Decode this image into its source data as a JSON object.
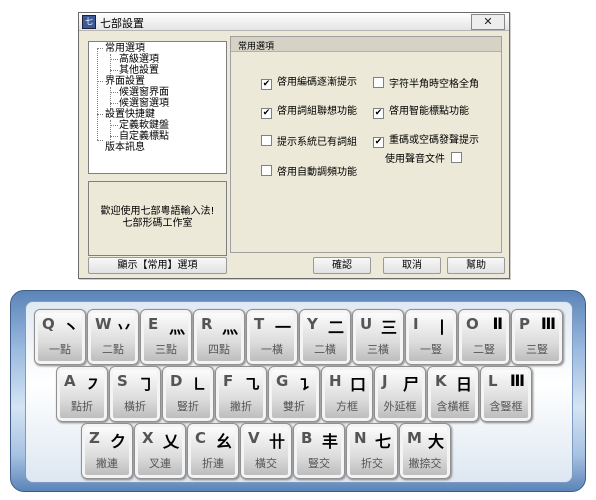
{
  "dialog": {
    "title": "七部設置",
    "app_icon": "七",
    "close_label": "✕",
    "tree": [
      {
        "label": "常用選項",
        "level": 0
      },
      {
        "label": "高級選項",
        "level": 1
      },
      {
        "label": "其他設置",
        "level": 1
      },
      {
        "label": "界面設置",
        "level": 0
      },
      {
        "label": "候選窗界面",
        "level": 1
      },
      {
        "label": "候選窗選項",
        "level": 1
      },
      {
        "label": "設置快捷鍵",
        "level": 0
      },
      {
        "label": "定義軟鍵盤",
        "level": 1
      },
      {
        "label": "自定義標點",
        "level": 1
      },
      {
        "label": "版本訊息",
        "level": 0
      }
    ],
    "welcome": {
      "line1": "歡迎使用七部粵語輸入法!",
      "line2": "七部形碼工作室"
    },
    "group_title": "常用選項",
    "options": [
      {
        "label": "啓用編碼逐漸提示",
        "checked": true
      },
      {
        "label": "字符半角時空格全角",
        "checked": false
      },
      {
        "label": "啓用詞組聯想功能",
        "checked": true
      },
      {
        "label": "啓用智能標點功能",
        "checked": true
      },
      {
        "label": "提示系統已有詞組",
        "checked": false
      },
      {
        "label": "重碼或空碼發聲提示",
        "checked": true
      },
      {
        "label": "啓用自動調頻功能",
        "checked": false
      }
    ],
    "sound_file_label": "使用聲音文件",
    "buttons": {
      "show": "顯示【常用】選項",
      "ok": "確認",
      "cancel": "取消",
      "help": "幫助"
    }
  },
  "keyboard": {
    "rows": [
      [
        {
          "letter": "Q",
          "stroke": "丶",
          "label": "一點"
        },
        {
          "letter": "W",
          "stroke": "丷",
          "label": "二點"
        },
        {
          "letter": "E",
          "stroke": "灬",
          "label": "三點"
        },
        {
          "letter": "R",
          "stroke": "灬",
          "label": "四點"
        },
        {
          "letter": "T",
          "stroke": "一",
          "label": "一橫"
        },
        {
          "letter": "Y",
          "stroke": "二",
          "label": "二橫"
        },
        {
          "letter": "U",
          "stroke": "三",
          "label": "三橫"
        },
        {
          "letter": "I",
          "stroke": "丨",
          "label": "一豎"
        },
        {
          "letter": "O",
          "stroke": "Ⅱ",
          "label": "二豎"
        },
        {
          "letter": "P",
          "stroke": "Ⅲ",
          "label": "三豎"
        }
      ],
      [
        {
          "letter": "A",
          "stroke": "㇇",
          "label": "點折"
        },
        {
          "letter": "S",
          "stroke": "㇆",
          "label": "橫折"
        },
        {
          "letter": "D",
          "stroke": "㇗",
          "label": "豎折"
        },
        {
          "letter": "F",
          "stroke": "㇈",
          "label": "撇折"
        },
        {
          "letter": "G",
          "stroke": "㇊",
          "label": "雙折"
        },
        {
          "letter": "H",
          "stroke": "口",
          "label": "方框"
        },
        {
          "letter": "J",
          "stroke": "尸",
          "label": "外延框"
        },
        {
          "letter": "K",
          "stroke": "日",
          "label": "含橫框"
        },
        {
          "letter": "L",
          "stroke": "Ⅲ",
          "label": "含豎框"
        }
      ],
      [
        {
          "letter": "Z",
          "stroke": "ク",
          "label": "撇連"
        },
        {
          "letter": "X",
          "stroke": "乂",
          "label": "叉連"
        },
        {
          "letter": "C",
          "stroke": "幺",
          "label": "折連"
        },
        {
          "letter": "V",
          "stroke": "卄",
          "label": "橫交"
        },
        {
          "letter": "B",
          "stroke": "丰",
          "label": "豎交"
        },
        {
          "letter": "N",
          "stroke": "七",
          "label": "折交"
        },
        {
          "letter": "M",
          "stroke": "大",
          "label": "撇捺交"
        }
      ]
    ]
  }
}
